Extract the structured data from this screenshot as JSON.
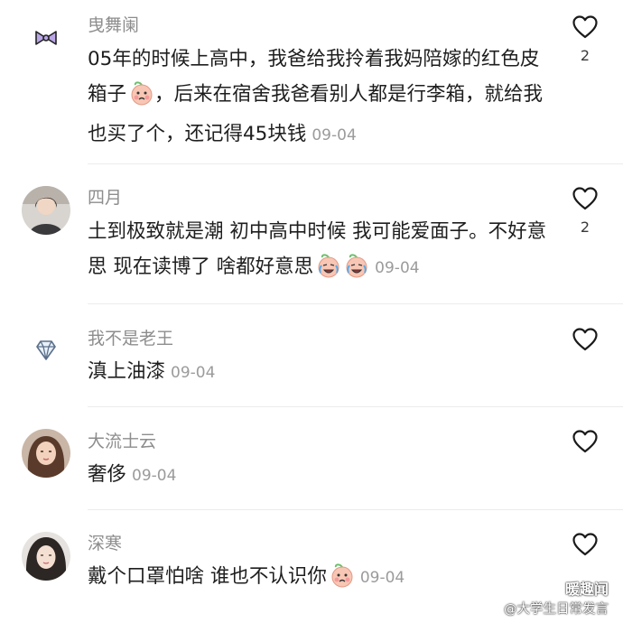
{
  "comments": [
    {
      "username": "曳舞阑",
      "text": "05年的时候上高中，我爸给我拎着我妈陪嫁的红色皮箱子",
      "text_after_emoji": "，后来在宿舍我爸看别人都是行李箱，就给我也买了个，还记得45块钱",
      "date": "09-04",
      "likes": "2",
      "avatar_icon": "ribbon-bow-icon",
      "emoji_icon": "peach-emoji-icon"
    },
    {
      "username": "四月",
      "text": "土到极致就是潮 初中高中时候 我可能爱面子。不好意思 现在读博了 啥都好意思",
      "date": "09-04",
      "likes": "2",
      "avatar_icon": "girl-photo-avatar",
      "emoji_icon": "crying-laugh-peach-emoji-icon"
    },
    {
      "username": "我不是老王",
      "text": "滇上油漆",
      "date": "09-04",
      "avatar_icon": "diamond-icon"
    },
    {
      "username": "大流士云",
      "text": "奢侈",
      "date": "09-04",
      "avatar_icon": "woman-portrait-avatar"
    },
    {
      "username": "深寒",
      "text": "戴个口罩怕啥 谁也不认识你",
      "date": "09-04",
      "avatar_icon": "woman-selfie-avatar",
      "emoji_icon": "peach-emoji-icon"
    }
  ],
  "watermark": {
    "title": "暖趣闻",
    "handle": "@大学生日常发言"
  },
  "colors": {
    "username": "#8d8d8d",
    "date": "#9b9b9b",
    "heart_stroke": "#1a1a1a",
    "peach": "#f6b7a3"
  }
}
